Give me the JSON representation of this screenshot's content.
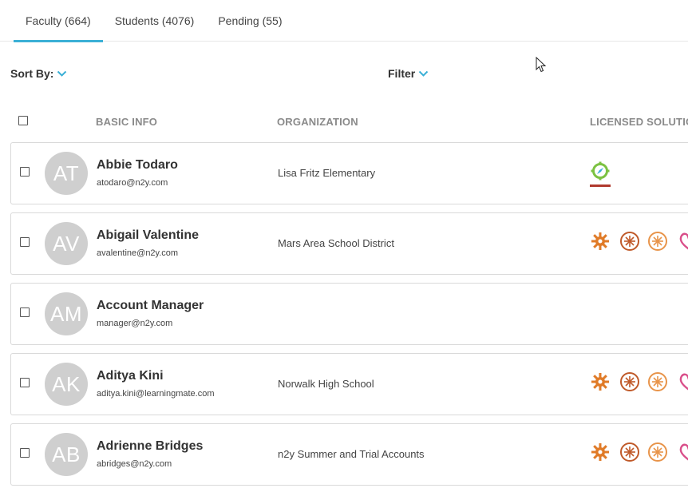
{
  "tabs": [
    {
      "label": "Faculty (664)",
      "active": true
    },
    {
      "label": "Students (4076)",
      "active": false
    },
    {
      "label": "Pending (55)",
      "active": false
    }
  ],
  "toolbar": {
    "sort_label": "Sort By:",
    "filter_label": "Filter"
  },
  "table": {
    "headers": {
      "basic_info": "BASIC INFO",
      "organization": "ORGANIZATION",
      "licensed": "LICENSED SOLUTIO"
    },
    "rows": [
      {
        "initials": "AT",
        "name": "Abbie Todaro",
        "email": "atodaro@n2y.com",
        "organization": "Lisa Fritz Elementary",
        "solutions": [
          "compass-icon"
        ]
      },
      {
        "initials": "AV",
        "name": "Abigail Valentine",
        "email": "avalentine@n2y.com",
        "organization": "Mars Area School District",
        "solutions": [
          "gear-icon",
          "snowflake-circle-icon",
          "snowflake-circle-icon",
          "heart-icon"
        ]
      },
      {
        "initials": "AM",
        "name": "Account Manager",
        "email": "manager@n2y.com",
        "organization": "",
        "solutions": []
      },
      {
        "initials": "AK",
        "name": "Aditya Kini",
        "email": "aditya.kini@learningmate.com",
        "organization": "Norwalk High School",
        "solutions": [
          "gear-icon",
          "snowflake-circle-icon",
          "snowflake-circle-icon",
          "heart-icon"
        ]
      },
      {
        "initials": "AB",
        "name": "Adrienne Bridges",
        "email": "abridges@n2y.com",
        "organization": "n2y Summer and Trial Accounts",
        "solutions": [
          "gear-icon",
          "snowflake-circle-icon",
          "snowflake-circle-icon",
          "heart-icon"
        ]
      }
    ]
  },
  "colors": {
    "accent": "#3bb0d6",
    "orange": "#e07b28",
    "brown": "#c05a2a",
    "pink": "#d94f8a",
    "green": "#7cc242",
    "avatar": "#cfcfcf"
  }
}
